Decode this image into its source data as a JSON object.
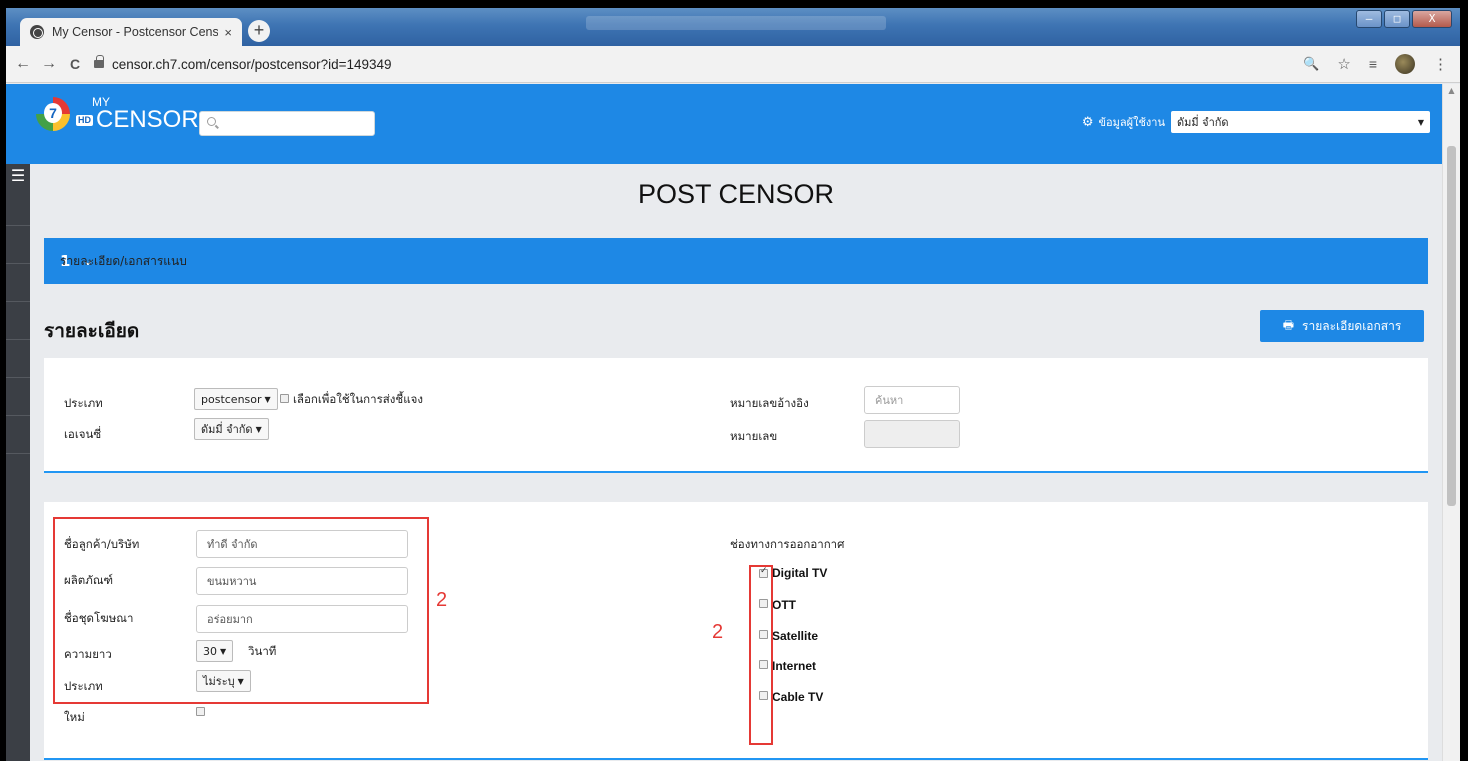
{
  "browser": {
    "tab_title": "My Censor - Postcensor Censor",
    "tab_close": "×",
    "new_tab": "+",
    "url": "censor.ch7.com/censor/postcensor?id=149349",
    "back": "←",
    "forward": "→",
    "reload": "C",
    "zoom_icon": "🔍",
    "star_icon": "☆",
    "menu_dots": "⋮",
    "window_buttons": [
      "–",
      "□",
      "X"
    ]
  },
  "header": {
    "logo_my": "MY",
    "logo_hd": "HD",
    "logo_censor": "CENSOR",
    "logo_number": "7",
    "user_label": "ข้อมูลผู้ใช้งาน",
    "user_value": "ดัมมี่ จำกัด"
  },
  "page": {
    "title": "POST CENSOR",
    "step_number": "1",
    "step_label": "รายละเอียด/เอกสารแนบ",
    "section_title": "รายละเอียด",
    "doc_button": "รายละเอียดเอกสาร"
  },
  "card1": {
    "type_label": "ประเภท",
    "type_value": "postcensor",
    "clarify_label": "เลือกเพื่อใช้ในการส่งชี้แจง",
    "agency_label": "เอเจนซี่",
    "agency_value": "ดัมมี่ จำกัด",
    "ref_label": "หมายเลขอ้างอิง",
    "ref_placeholder": "ค้นหา",
    "number_label": "หมายเลข"
  },
  "card2": {
    "customer_label": "ชื่อลูกค้า/บริษัท",
    "customer_value": "ทำดี จำกัด",
    "product_label": "ผลิตภัณฑ์",
    "product_value": "ขนมหวาน",
    "ad_label": "ชื่อชุดโฆษณา",
    "ad_value": "อร่อยมาก",
    "length_label": "ความยาว",
    "length_value": "30",
    "length_unit": "วินาที",
    "type_label": "ประเภท",
    "type_value": "ไม่ระบุ",
    "new_label": "ใหม่",
    "channel_title": "ช่องทางการออกอากาศ",
    "channels": [
      {
        "label": "Digital TV",
        "checked": true
      },
      {
        "label": "OTT",
        "checked": false
      },
      {
        "label": "Satellite",
        "checked": false
      },
      {
        "label": "Internet",
        "checked": false
      },
      {
        "label": "Cable TV",
        "checked": false
      }
    ],
    "annotation_left": "2",
    "annotation_right": "2"
  },
  "colors": {
    "primary": "#1e88e5",
    "annotation": "#e53935"
  }
}
